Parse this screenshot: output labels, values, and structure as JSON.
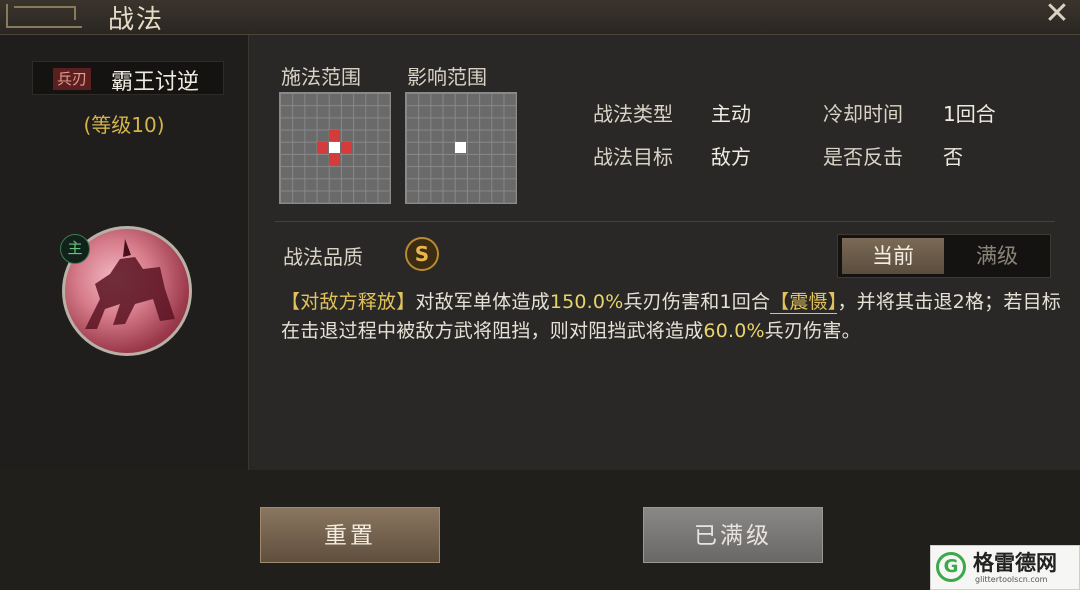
{
  "window": {
    "title": "战法",
    "close_icon": "close-icon"
  },
  "skill": {
    "weapon_tag": "兵刃",
    "name": "霸王讨逆",
    "level": "(等级10)",
    "badge": "主"
  },
  "ranges": {
    "cast_label": "施法范围",
    "effect_label": "影响范围"
  },
  "info": {
    "type_label": "战法类型",
    "type_value": "主动",
    "cooldown_label": "冷却时间",
    "cooldown_value": "1回合",
    "target_label": "战法目标",
    "target_value": "敌方",
    "counter_label": "是否反击",
    "counter_value": "否"
  },
  "quality": {
    "label": "战法品质",
    "grade": "S"
  },
  "toggle": {
    "current": "当前",
    "max": "满级"
  },
  "description": {
    "p1": "【对敌方释放】",
    "p2": "对敌军单体造成",
    "p3": "150.0%",
    "p4": "兵刃伤害和1回合",
    "p5": "【震慑】",
    "p6": "，并将其击退2格；若目标在击退过程中被敌方武将阻挡，则对阻挡武将造成",
    "p7": "60.0%",
    "p8": "兵刃伤害。"
  },
  "buttons": {
    "reset": "重置",
    "maxed": "已满级"
  },
  "watermark": {
    "logo": "G",
    "name": "格雷德网",
    "url": "glittertoolscn.com"
  },
  "colors": {
    "gold": "#e2c25a",
    "selected_cell": "#ffffff",
    "range_cell": "#d43b3b"
  }
}
